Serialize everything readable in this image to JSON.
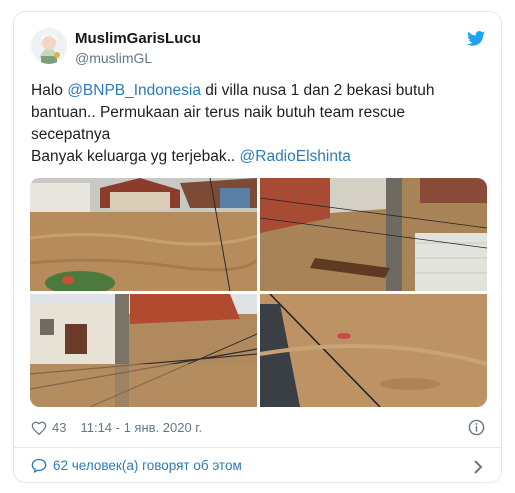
{
  "tweet": {
    "author_name": "MuslimGarisLucu",
    "author_handle": "@muslimGL",
    "text_parts": {
      "p1": "Halo ",
      "mention1": "@BNPB_Indonesia",
      "p2": " di villa nusa 1 dan 2 bekasi butuh bantuan.. Permukaan air terus naik butuh team rescue secepatnya",
      "p3": "Banyak keluarga yg terjebak.. ",
      "mention2": "@RadioElshinta"
    },
    "likes": "43",
    "timestamp": "11:14 - 1 янв. 2020 г.",
    "conversation": "62 человек(а) говорят об этом"
  },
  "colors": {
    "link": "#2b7bb9",
    "muted": "#657786",
    "border": "#e1e8ed",
    "twitter_blue": "#1da1f2"
  },
  "icons": [
    "avatar",
    "twitter-bird-icon",
    "heart-icon",
    "info-icon",
    "comment-bubble-icon",
    "chevron-right-icon"
  ]
}
